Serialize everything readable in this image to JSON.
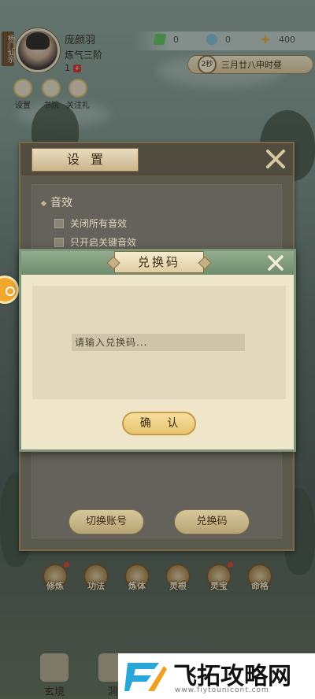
{
  "player": {
    "sect": "杨门仙宗",
    "name": "庞颜羽",
    "realm": "炼气三阶",
    "level": "1"
  },
  "resources": [
    {
      "icon": "jade-icon",
      "value": "0"
    },
    {
      "icon": "spirit-stone-icon",
      "value": "0"
    },
    {
      "icon": "gold-icon",
      "value": "400"
    }
  ],
  "time": {
    "seconds": "2秒",
    "date": "三月廿八申时昼"
  },
  "quick_icons": [
    {
      "icon": "settings-icon",
      "label": "设置"
    },
    {
      "icon": "book-icon",
      "label": "书院"
    },
    {
      "icon": "gift-icon",
      "label": "关注礼"
    }
  ],
  "settings": {
    "title": "设置",
    "section_sound": "音效",
    "options": [
      "关闭所有音效",
      "只开启关键音效"
    ],
    "switch_account": "切换账号",
    "redeem_code": "兑换码"
  },
  "redeem_dialog": {
    "title": "兑换码",
    "placeholder": "请输入兑换码...",
    "confirm": "确 认"
  },
  "functions": [
    {
      "label": "修炼",
      "dot": true
    },
    {
      "label": "功法",
      "dot": false
    },
    {
      "label": "炼体",
      "dot": false
    },
    {
      "label": "灵根",
      "dot": false
    },
    {
      "label": "灵宝",
      "dot": true
    },
    {
      "label": "命格",
      "dot": false
    }
  ],
  "bottom_nav": [
    {
      "label": "玄境"
    },
    {
      "label": "洞"
    }
  ],
  "watermark": {
    "text": "飞拓攻略网",
    "sub": "www.fiytounicont.com"
  },
  "colors": {
    "accent_green": "#7c9478",
    "button_gold": "#e7c46e",
    "panel_bg": "#efe5c9"
  }
}
